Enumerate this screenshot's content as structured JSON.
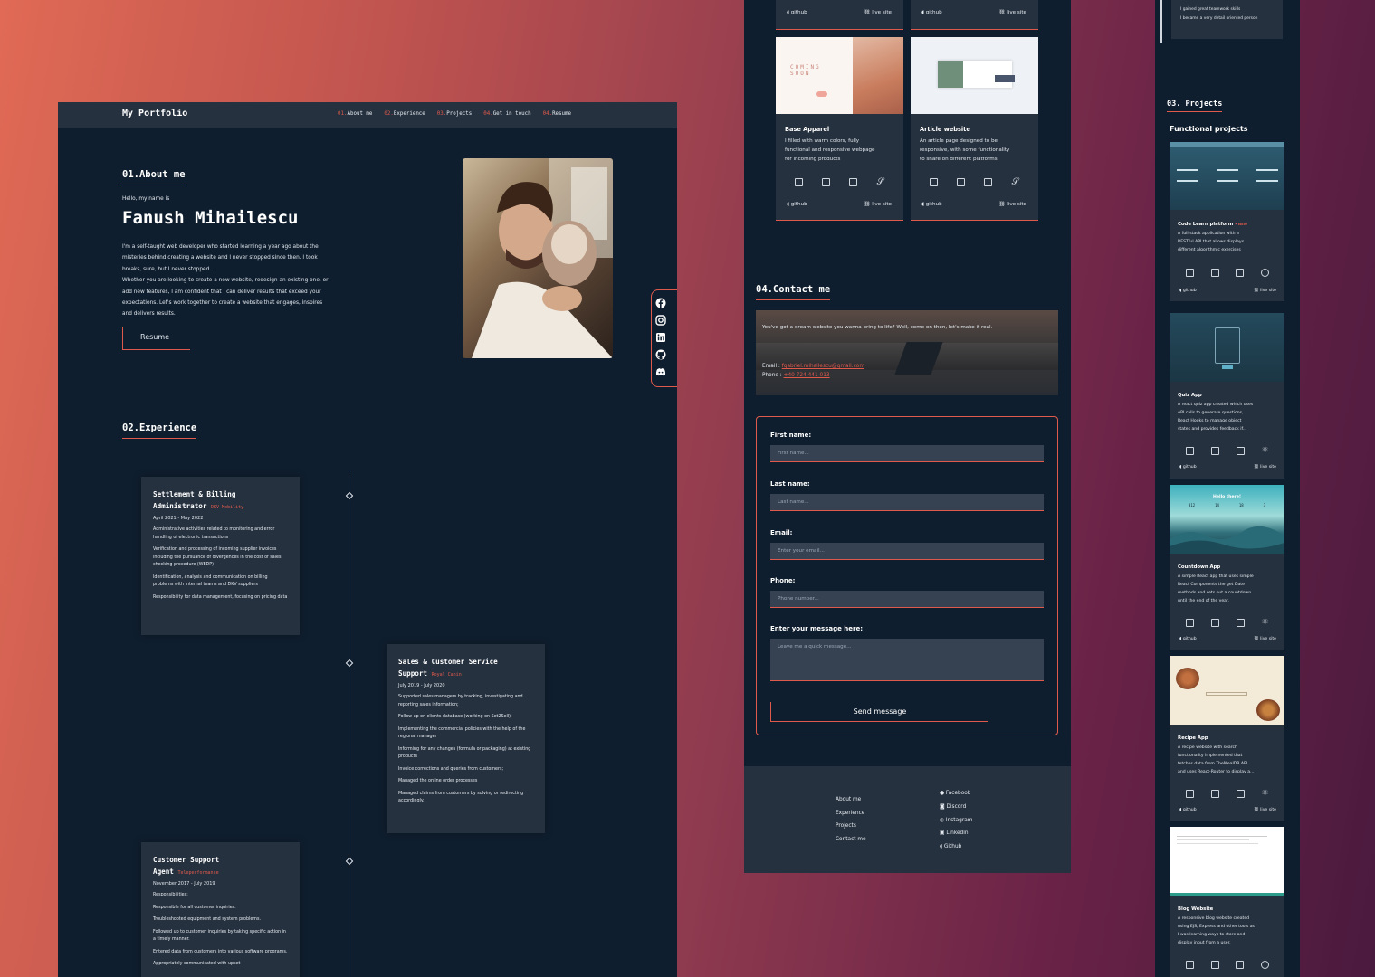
{
  "portfolio": {
    "brand": "My Portfolio",
    "nav": [
      {
        "num": "01.",
        "label": "About me"
      },
      {
        "num": "02.",
        "label": "Experience"
      },
      {
        "num": "03.",
        "label": "Projects"
      },
      {
        "num": "04.",
        "label": "Get in touch"
      },
      {
        "num": "04.",
        "label": "Resume"
      }
    ],
    "about": {
      "title": "01.About me",
      "greeting": "Hello, my name is",
      "name": "Fanush Mihailescu",
      "bio": [
        "I'm a self-taught web developer who started learning a year ago about the",
        "misteries behind creating a website and I never stopped since then. I took",
        "breaks, sure, but I never stopped.",
        "Whether you are looking to create a new website, redesign an existing one, or",
        "add new features, I am confident that I can deliver results that exceed your",
        "expectations. Let's work together to create a website that engages, inspires",
        "and delivers results."
      ],
      "resume_button": "Resume"
    },
    "social_icons": [
      "facebook-icon",
      "instagram-icon",
      "linkedin-icon",
      "github-icon",
      "discord-icon"
    ],
    "experience": {
      "title": "02.Experience",
      "jobs": [
        {
          "title_line1": "Settlement & Billing",
          "title_line2": "Administrator",
          "company": "DKV Mobility",
          "dates": "April 2021 - May 2022",
          "items": [
            "Administrative activities related to monitoring and error handling of electronic transactions",
            "Verification and processing of incoming supplier invoices including the pursuance of divergences in the cost of sales checking procedure (WEDP)",
            "Identification, analysis and communication on billing problems with internal teams and DKV suppliers",
            "Responsibility for data management, focusing on pricing data"
          ]
        },
        {
          "title_line1": "Sales & Customer Service",
          "title_line2": "Support",
          "company": "Royal Canin",
          "dates": "July 2019 - July 2020",
          "items": [
            "Supported sales managers by tracking, investigating and reporting sales information;",
            "Follow up on clients database (working on Set2Sell);",
            "Implementing the commercial policies with the help of the regional manager",
            "Informing for any changes (formula or packaging) at existing products",
            "Invoice corrections and queries from customers;",
            "Managed the online order processes",
            "Managed claims from customers by solving or redirecting accordingly."
          ]
        },
        {
          "title_line1": "Customer Support",
          "title_line2": "Agent",
          "company": "Teleperformance",
          "dates": "November 2017 - July 2019",
          "items": [
            "Responsibilities:",
            "Responsible for all customer inquiries.",
            "Troubleshooted equipment and system problems.",
            "Followed up to customer inquiries by taking specific action in a timely manner.",
            "Entered data from customers into various software programs.",
            "Appropriately communicated with upset"
          ]
        }
      ]
    }
  },
  "middle": {
    "top_links": [
      {
        "github": "github",
        "live": "live site"
      },
      {
        "github": "github",
        "live": "live site"
      }
    ],
    "projects": [
      {
        "title": "Base Apparel",
        "desc": [
          "I filled with warm colors, fully",
          "functional and responsive webpage",
          "for incoming products"
        ],
        "github": "github",
        "live": "live site",
        "thumb_text": "COMING SOON"
      },
      {
        "title": "Article website",
        "desc": [
          "An article page designed to be",
          "responsive, with some functionality",
          "to share on different platforms."
        ],
        "github": "github",
        "live": "live site"
      }
    ],
    "contact": {
      "title": "04.Contact me",
      "banner_text": "You've got a dream website you wanna bring to life? Well, come on then, let's make it real.",
      "email_label": "Email : ",
      "email": "fgabriel.mihailescu@gmail.com",
      "phone_label": "Phone : ",
      "phone": "+40 724 441 013",
      "fields": [
        {
          "label": "First name:",
          "placeholder": "First name..."
        },
        {
          "label": "Last name:",
          "placeholder": "Last name..."
        },
        {
          "label": "Email:",
          "placeholder": "Enter your email..."
        },
        {
          "label": "Phone:",
          "placeholder": "Phone number..."
        }
      ],
      "message_label": "Enter your message here:",
      "message_placeholder": "Leave me a quick message...",
      "send": "Send message"
    },
    "footer": {
      "links": [
        "About me",
        "Experience",
        "Projects",
        "Contact me"
      ],
      "social": [
        {
          "icon": "facebook-icon",
          "label": "Facebook"
        },
        {
          "icon": "discord-icon",
          "label": "Discord"
        },
        {
          "icon": "instagram-icon",
          "label": "Instagram"
        },
        {
          "icon": "linkedin-icon",
          "label": "Linkedin"
        },
        {
          "icon": "github-icon",
          "label": "Github"
        }
      ]
    }
  },
  "right": {
    "top_lines": [
      "I gained great teamwork skills",
      "I became a very detail oriented person"
    ],
    "section_title": "03. Projects",
    "subtitle": "Functional projects",
    "projects": [
      {
        "title": "Code Learn platform",
        "badge": "• NEW",
        "desc": [
          "A full-stack application with a",
          "RESTful API that allows displays",
          "different algorithmic exercises"
        ],
        "github": "github",
        "live": "live site"
      },
      {
        "title": "Quiz App",
        "desc": [
          "A react quiz app created which uses",
          "API calls to generate questions,",
          "React Hooks to manage object",
          "states and provides feedback if..."
        ],
        "github": "github",
        "live": "live site"
      },
      {
        "title": "Countdown App",
        "desc": [
          "A simple React app that uses simple",
          "React Components the get Date",
          "methods and sets out a countdown",
          "until the end of the year."
        ],
        "github": "github",
        "live": "live site",
        "thumb_text": "Hello there!",
        "thumb_nums": [
          "312",
          "14",
          "18",
          "3"
        ]
      },
      {
        "title": "Recipe App",
        "desc": [
          "A recipe website with search",
          "functionality implemented that",
          "fetches data from TheMealDB API",
          "and uses React-Router to display a..."
        ],
        "github": "github",
        "live": "live site"
      },
      {
        "title": "Blog Website",
        "desc": [
          "A responsive blog website created",
          "using EJS, Express and other tools as",
          "I was learning ways to store and",
          "display input from a user."
        ]
      }
    ]
  },
  "colors": {
    "accent": "#e05a4c",
    "panel": "#0f1e2e",
    "card": "#26313f"
  }
}
